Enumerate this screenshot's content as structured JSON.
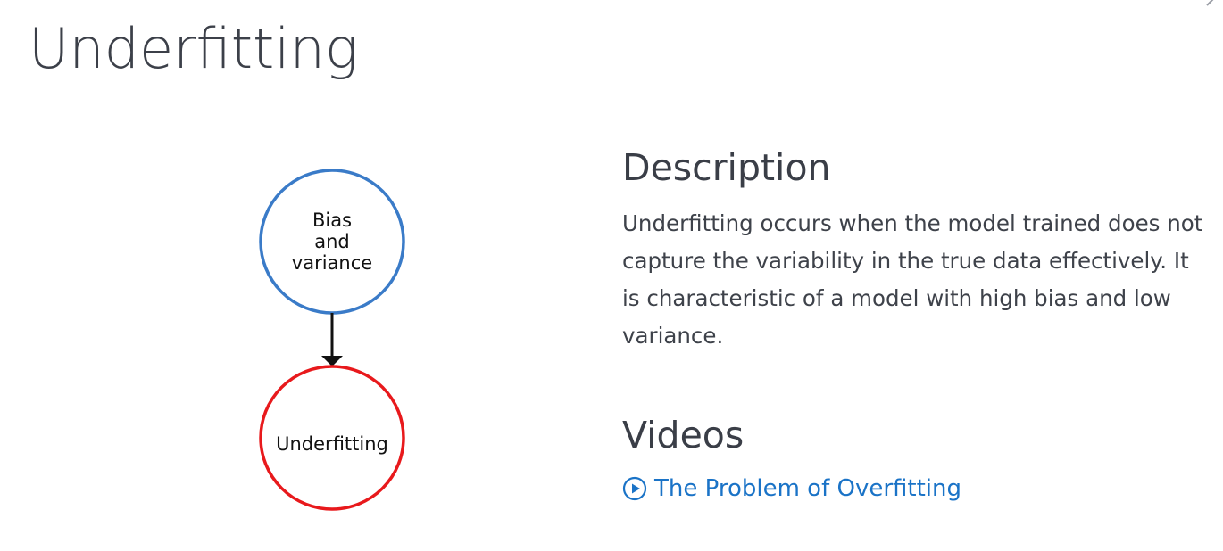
{
  "page": {
    "title": "Underfitting"
  },
  "diagram": {
    "nodes": [
      {
        "id": "bias-variance",
        "label_lines": [
          "Bias",
          "and",
          "variance"
        ],
        "border_color": "#3a7bc8"
      },
      {
        "id": "underfitting",
        "label_lines": [
          "Underfitting"
        ],
        "border_color": "#e8191c"
      }
    ],
    "edges": [
      {
        "from": "bias-variance",
        "to": "underfitting",
        "color": "#111111"
      }
    ]
  },
  "description": {
    "heading": "Description",
    "text": "Underfitting occurs when the model trained does not capture the variability in the true data effectively. It is characteristic of a model with high bias and low variance."
  },
  "videos": {
    "heading": "Videos",
    "items": [
      {
        "label": "The Problem of Overfitting",
        "icon": "play-circle-icon"
      }
    ]
  },
  "colors": {
    "link": "#1a73c7",
    "text": "#3e424a",
    "node_blue": "#3a7bc8",
    "node_red": "#e8191c"
  }
}
